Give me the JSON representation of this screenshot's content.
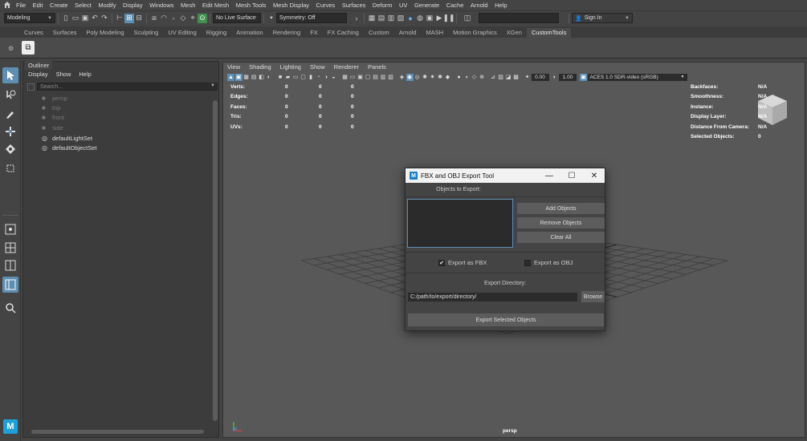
{
  "menubar": [
    "File",
    "Edit",
    "Create",
    "Select",
    "Modify",
    "Display",
    "Windows",
    "Mesh",
    "Edit Mesh",
    "Mesh Tools",
    "Mesh Display",
    "Curves",
    "Surfaces",
    "Deform",
    "UV",
    "Generate",
    "Cache",
    "Arnold",
    "Help"
  ],
  "statusline": {
    "mode": "Modeling",
    "live_surface": "No Live Surface",
    "symmetry": "Symmetry: Off",
    "sign_in": "Sign In"
  },
  "shelf_tabs": [
    "Curves",
    "Surfaces",
    "Poly Modeling",
    "Sculpting",
    "UV Editing",
    "Rigging",
    "Animation",
    "Rendering",
    "FX",
    "FX Caching",
    "Custom",
    "Arnold",
    "MASH",
    "Motion Graphics",
    "XGen",
    "CustomTools"
  ],
  "outliner": {
    "tab": "Outliner",
    "menu": [
      "Display",
      "Show",
      "Help"
    ],
    "search_placeholder": "Search...",
    "items": [
      {
        "label": "persp",
        "dim": true
      },
      {
        "label": "top",
        "dim": true
      },
      {
        "label": "front",
        "dim": true
      },
      {
        "label": "side",
        "dim": true
      },
      {
        "label": "defaultLightSet",
        "dim": false
      },
      {
        "label": "defaultObjectSet",
        "dim": false
      }
    ]
  },
  "viewport": {
    "menu": [
      "View",
      "Shading",
      "Lighting",
      "Show",
      "Renderer",
      "Panels"
    ],
    "exposure": "0.00",
    "gamma": "1.00",
    "color_space": "ACES 1.0 SDR-video (sRGB)",
    "camera": "persp",
    "hud_left": [
      {
        "label": "Verts:",
        "v1": "0",
        "v2": "0",
        "v3": "0"
      },
      {
        "label": "Edges:",
        "v1": "0",
        "v2": "0",
        "v3": "0"
      },
      {
        "label": "Faces:",
        "v1": "0",
        "v2": "0",
        "v3": "0"
      },
      {
        "label": "Tris:",
        "v1": "0",
        "v2": "0",
        "v3": "0"
      },
      {
        "label": "UVs:",
        "v1": "0",
        "v2": "0",
        "v3": "0"
      }
    ],
    "hud_right": [
      {
        "label": "Backfaces:",
        "value": "N/A"
      },
      {
        "label": "Smoothness:",
        "value": "N/A"
      },
      {
        "label": "Instance:",
        "value": "N/A"
      },
      {
        "label": "Display Layer:",
        "value": "N/A"
      },
      {
        "label": "Distance From Camera:",
        "value": "N/A"
      },
      {
        "label": "Selected Objects:",
        "value": "0"
      }
    ]
  },
  "dialog": {
    "title": "FBX and OBJ Export Tool",
    "objects_label": "Objects to Export:",
    "add_button": "Add Objects",
    "remove_button": "Remove Objects",
    "clear_button": "Clear All",
    "export_fbx_label": "Export as FBX",
    "export_fbx_checked": true,
    "export_obj_label": "Export as OBJ",
    "export_obj_checked": false,
    "directory_label": "Export Directory:",
    "directory_value": "C:/path/to/export/directory/",
    "browse_button": "Browse",
    "export_button": "Export Selected Objects"
  },
  "colors": {
    "accent": "#5d8fb3",
    "panel": "#444444",
    "viewport": "#585858"
  }
}
